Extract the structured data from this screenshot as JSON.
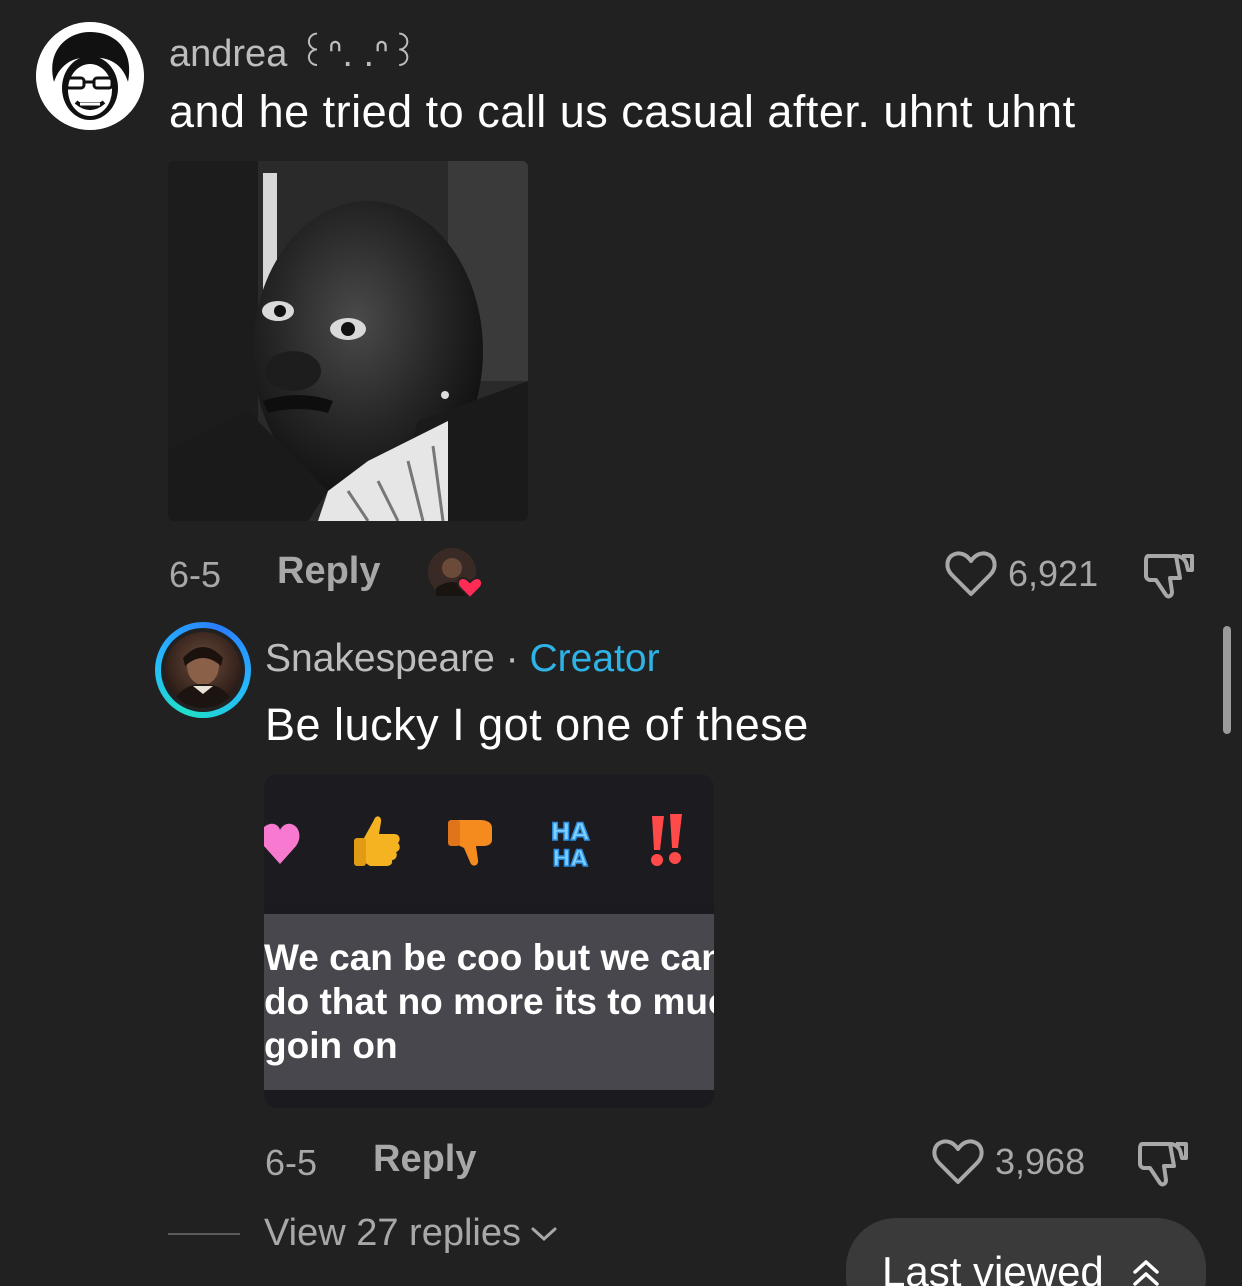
{
  "comment": {
    "username": "andrea ꒰ᐢ. .ᐢ꒱",
    "text": "and he tried to call us casual after. uhnt uhnt",
    "date": "6-5",
    "reply_label": "Reply",
    "likes": "6,921"
  },
  "creator_reply": {
    "username": "Snakespeare",
    "separator": " · ",
    "badge": "Creator",
    "text": "Be lucky I got one of these",
    "embedded_message": "We can be coo but we can\ndo that no more its to muc\ngoin on",
    "reactions": [
      "heart",
      "thumbs-up",
      "thumbs-down",
      "HA HA",
      "!!"
    ],
    "date": "6-5",
    "reply_label": "Reply",
    "likes": "3,968"
  },
  "view_replies": "View 27 replies",
  "last_viewed": "Last viewed",
  "colors": {
    "background": "#212121",
    "creator_accent": "#2fb3e6",
    "like_heart_badge": "#fe2c55"
  }
}
